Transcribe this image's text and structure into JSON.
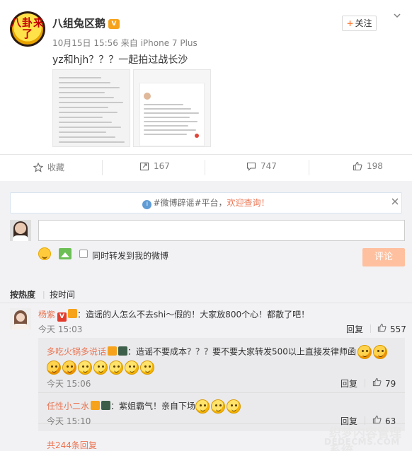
{
  "post": {
    "username": "八组兔区鹅",
    "vip_badge": "V",
    "meta": "10月15日 15:56 来自 iPhone 7 Plus",
    "text": "yz和hjh？？？一起拍过战长沙",
    "follow_label": "关注",
    "follow_plus": "+",
    "avatar_text": "八卦来了"
  },
  "actions": {
    "favorite_label": "收藏",
    "repost_count": "167",
    "comment_count": "747",
    "like_count": "198"
  },
  "notice": {
    "prefix": "#微博辟谣#平台，",
    "link": "欢迎查询！"
  },
  "compose": {
    "repost_label": "同时转发到我的微博",
    "submit_label": "评论"
  },
  "sort": {
    "hot": "按热度",
    "sep": "|",
    "time": "按时间"
  },
  "comments": [
    {
      "name": "杨紫",
      "text": "：造谣的人怎么不去shi～假的！大家放800个心！都散了吧！",
      "time": "今天 15:03",
      "reply": "回复",
      "likes": "557"
    }
  ],
  "sub_comments": [
    {
      "name": "多吃火锅多说话",
      "text": "：造谣不要成本？？？要不要大家转发500以上直接发律师函",
      "time": "今天 15:06",
      "reply": "回复",
      "likes": "79"
    },
    {
      "name": "任性小二水",
      "text": "：紫姐霸气！亲自下场",
      "time": "今天 15:10",
      "reply": "回复",
      "likes": "63"
    }
  ],
  "total_replies": "共244条回复",
  "watermark": {
    "line1": "织梦内容管理系统",
    "line2": "DEDECMS.COM"
  }
}
